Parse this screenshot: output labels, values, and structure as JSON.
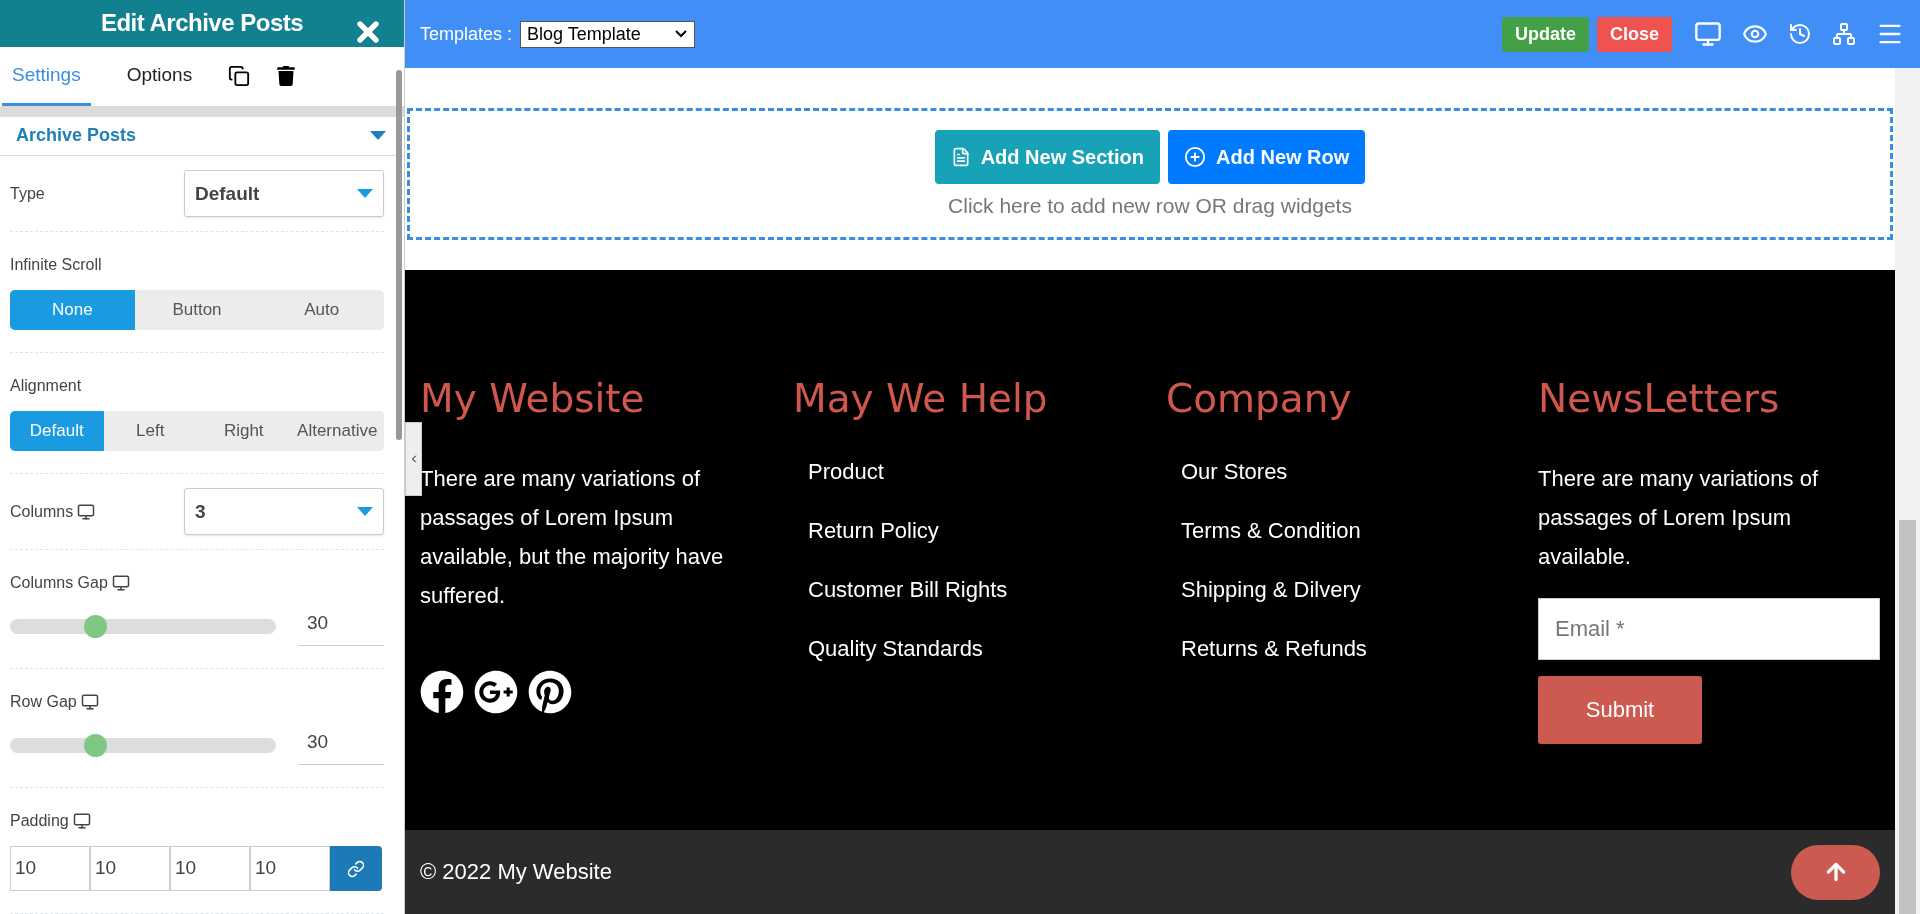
{
  "panel": {
    "title": "Edit Archive Posts",
    "tabs": [
      {
        "label": "Settings",
        "selected": true
      },
      {
        "label": "Options",
        "selected": false
      }
    ],
    "section": {
      "title": "Archive Posts",
      "expanded": true
    },
    "rows": [
      {
        "kind": "select",
        "label": "Type",
        "responsive": false,
        "value": "Default"
      },
      {
        "kind": "segmented",
        "label": "Infinite Scroll",
        "responsive": false,
        "options": [
          {
            "label": "None",
            "selected": true
          },
          {
            "label": "Button",
            "selected": false
          },
          {
            "label": "Auto",
            "selected": false
          }
        ]
      },
      {
        "kind": "segmented",
        "label": "Alignment",
        "responsive": false,
        "options": [
          {
            "label": "Default",
            "selected": true
          },
          {
            "label": "Left",
            "selected": false
          },
          {
            "label": "Right",
            "selected": false
          },
          {
            "label": "Alternative",
            "selected": false
          }
        ]
      },
      {
        "kind": "select",
        "label": "Columns",
        "responsive": true,
        "value": "3"
      },
      {
        "kind": "slider",
        "label": "Columns Gap",
        "responsive": true,
        "level": 0.32,
        "value": "30"
      },
      {
        "kind": "slider",
        "label": "Row Gap",
        "responsive": true,
        "level": 0.32,
        "value": "30"
      },
      {
        "kind": "padding",
        "label": "Padding",
        "responsive": true,
        "values": [
          "10",
          "10",
          "10",
          "10"
        ]
      }
    ]
  },
  "toolbar": {
    "templates_label": "Templates :",
    "template": "Blog Template",
    "buttons": [
      {
        "label": "Update",
        "kind": "update"
      },
      {
        "label": "Close",
        "kind": "close"
      }
    ]
  },
  "drop_zone": {
    "buttons": [
      {
        "label": "Add New Section",
        "kind": "section"
      },
      {
        "label": "Add New Row",
        "kind": "row"
      }
    ],
    "hint": "Click here to add new row OR drag widgets"
  },
  "footer": {
    "columns": [
      {
        "kind": "text",
        "heading": "My Website",
        "text": "There are many variations of passages of Lorem Ipsum available, but the majority have suffered.",
        "social": [
          {
            "kind": "facebook"
          },
          {
            "kind": "google-plus"
          },
          {
            "kind": "pinterest"
          }
        ]
      },
      {
        "kind": "links",
        "heading": "May We Help",
        "links": [
          "Product",
          "Return Policy",
          "Customer Bill Rights",
          "Quality Standards"
        ]
      },
      {
        "kind": "links",
        "heading": "Company",
        "links": [
          "Our Stores",
          "Terms & Condition",
          "Shipping & Dilvery",
          "Returns & Refunds"
        ]
      },
      {
        "kind": "newsletter",
        "heading": "NewsLetters",
        "text": "There are many variations of passages of Lorem Ipsum available.",
        "placeholder": "Email *",
        "button": "Submit"
      }
    ],
    "copyright": "© 2022 My Website"
  }
}
